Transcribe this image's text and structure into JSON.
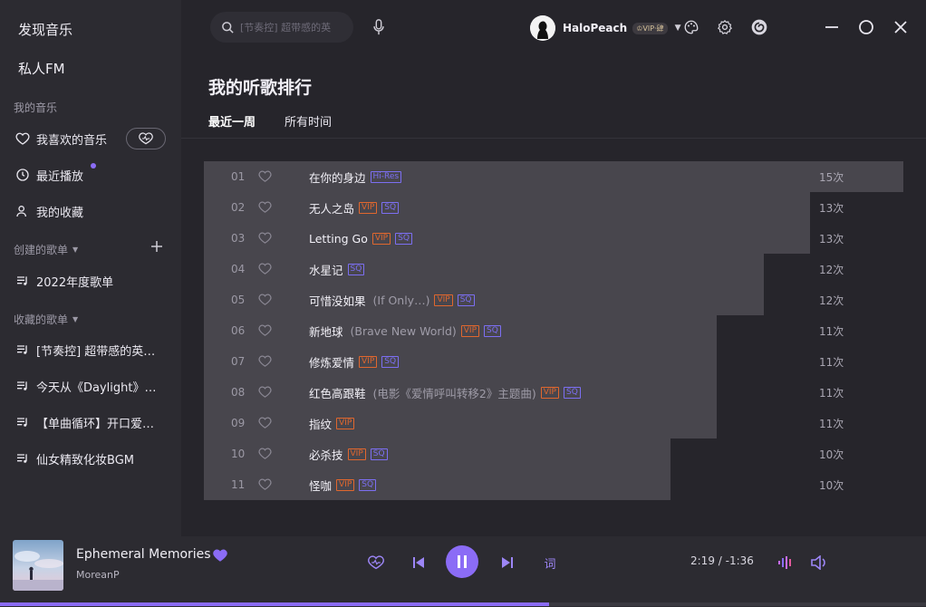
{
  "sidebar": {
    "discover": "发现音乐",
    "fm": "私人FM",
    "my_music_header": "我的音乐",
    "liked": "我喜欢的音乐",
    "recent": "最近播放",
    "collection": "我的收藏",
    "created_header": "创建的歌单",
    "created_playlists": [
      "2022年度歌单"
    ],
    "collected_header": "收藏的歌单",
    "collected_playlists": [
      "[节奏控] 超带感的英…",
      "今天从《Daylight》…",
      "【单曲循环】开口爱…",
      "仙女精致化妆BGM"
    ]
  },
  "topbar": {
    "search_placeholder": "[节奏控] 超带感的英",
    "username": "HaloPeach",
    "vip_badge": "♔VIP·肆"
  },
  "page": {
    "title": "我的听歌排行",
    "tabs": [
      "最近一周",
      "所有时间"
    ]
  },
  "ranking": [
    {
      "num": "01",
      "title": "在你的身边",
      "alias": "",
      "tags": [
        "Hi-Res"
      ],
      "count": "15次",
      "plays": 15
    },
    {
      "num": "02",
      "title": "无人之岛",
      "alias": "",
      "tags": [
        "VIP",
        "SQ"
      ],
      "count": "13次",
      "plays": 13
    },
    {
      "num": "03",
      "title": "Letting Go",
      "alias": "",
      "tags": [
        "VIP",
        "SQ"
      ],
      "count": "13次",
      "plays": 13
    },
    {
      "num": "04",
      "title": "水星记",
      "alias": "",
      "tags": [
        "SQ"
      ],
      "count": "12次",
      "plays": 12
    },
    {
      "num": "05",
      "title": "可惜没如果",
      "alias": "(If Only…)",
      "tags": [
        "VIP",
        "SQ"
      ],
      "count": "12次",
      "plays": 12
    },
    {
      "num": "06",
      "title": "新地球",
      "alias": "(Brave New World)",
      "tags": [
        "VIP",
        "SQ"
      ],
      "count": "11次",
      "plays": 11
    },
    {
      "num": "07",
      "title": "修炼爱情",
      "alias": "",
      "tags": [
        "VIP",
        "SQ"
      ],
      "count": "11次",
      "plays": 11
    },
    {
      "num": "08",
      "title": "红色高跟鞋",
      "alias": "(电影《爱情呼叫转移2》主题曲)",
      "tags": [
        "VIP",
        "SQ"
      ],
      "count": "11次",
      "plays": 11
    },
    {
      "num": "09",
      "title": "指纹",
      "alias": "",
      "tags": [
        "VIP"
      ],
      "count": "11次",
      "plays": 11
    },
    {
      "num": "10",
      "title": "必杀技",
      "alias": "",
      "tags": [
        "VIP",
        "SQ"
      ],
      "count": "10次",
      "plays": 10
    },
    {
      "num": "11",
      "title": "怪咖",
      "alias": "",
      "tags": [
        "VIP",
        "SQ"
      ],
      "count": "10次",
      "plays": 10
    }
  ],
  "player": {
    "song_title": "Ephemeral Memories",
    "artist": "MoreanP",
    "time": "2:19 / -1:36",
    "lyric_label": "词",
    "progress": 0.593
  },
  "colors": {
    "accent": "#8b6cf6",
    "vip": "#e0672e",
    "sq": "#7c6ff2"
  }
}
